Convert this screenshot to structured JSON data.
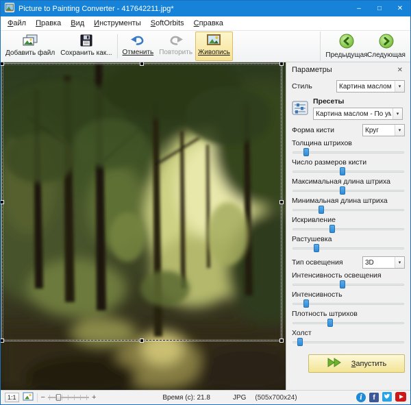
{
  "window": {
    "title": "Picture to Painting Converter - 417642211.jpg*"
  },
  "icons": {
    "minimize": "–",
    "maximize": "□",
    "close": "✕",
    "panel_close": "✕",
    "dropdown_arrow": "▾",
    "zoom_out": "−",
    "zoom_in": "+",
    "info": "i",
    "facebook": "f"
  },
  "menu": {
    "items": [
      {
        "label": "Файл"
      },
      {
        "label": "Правка"
      },
      {
        "label": "Вид"
      },
      {
        "label": "Инструменты"
      },
      {
        "label": "SoftOrbits"
      },
      {
        "label": "Справка"
      }
    ]
  },
  "toolbar": {
    "add_file": "Добавить файл",
    "save_as": "Сохранить как...",
    "undo": "Отменить",
    "redo": "Повторить",
    "paint": "Живопись",
    "prev": "Предыдущая",
    "next": "Следующая"
  },
  "panel": {
    "title": "Параметры",
    "style_label": "Стиль",
    "style_value": "Картина маслом",
    "presets_label": "Пресеты",
    "presets_value": "Картина маслом - По умолча",
    "brush_label": "Форма кисти",
    "brush_value": "Круг",
    "lighting_label": "Тип освещения",
    "lighting_value": "3D",
    "sliders_top": [
      {
        "label": "Толщина штрихов",
        "percent": 13
      },
      {
        "label": "Число размеров кисти",
        "percent": 45
      },
      {
        "label": "Максимальная длина штриха",
        "percent": 45
      },
      {
        "label": "Минимальная длина штриха",
        "percent": 26
      },
      {
        "label": "Искривление",
        "percent": 36
      },
      {
        "label": "Растушевка",
        "percent": 22
      }
    ],
    "sliders_bottom": [
      {
        "label": "Интенсивность освещения",
        "percent": 45
      },
      {
        "label": "Интенсивность",
        "percent": 13
      },
      {
        "label": "Плотность штрихов",
        "percent": 34
      },
      {
        "label": "Холст",
        "percent": 7
      }
    ],
    "run_button": "Запустить"
  },
  "statusbar": {
    "scale_button": "1:1",
    "time": "Время (с): 21.8",
    "format": "JPG",
    "dimensions": "(505x700x24)"
  },
  "colors": {
    "titlebar": "#1683d8",
    "accent_blue": "#3a97dd",
    "toolbar_active_bg": "#f6e296",
    "run_button_bg": "#f3e493",
    "run_arrow_green": "#63ad2d"
  }
}
